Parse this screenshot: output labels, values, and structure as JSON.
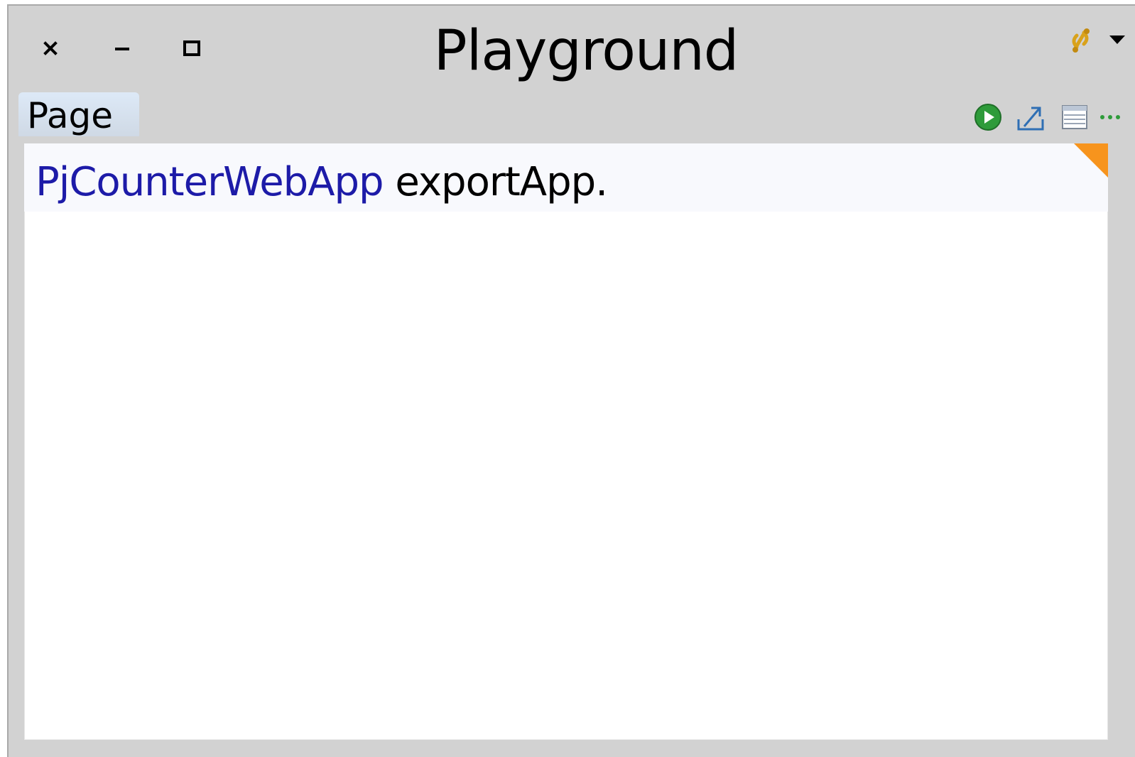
{
  "window": {
    "title": "Playground",
    "controls": {
      "close_icon": "close-icon",
      "minimize_icon": "minimize-icon",
      "maximize_icon": "maximize-icon"
    },
    "menu_icon": "window-menu-icon"
  },
  "tabs": [
    {
      "label": "Page",
      "selected": true
    }
  ],
  "toolbar": {
    "icons": [
      "run-icon",
      "export-icon",
      "inspect-icon",
      "more-icon"
    ]
  },
  "editor": {
    "code": {
      "receiver": "PjCounterWebApp",
      "message": " exportApp."
    },
    "corner_badge_color": "#f7941d"
  },
  "colors": {
    "window_background": "#d2d2d2",
    "tab_background": "#dde9f7",
    "class_name": "#1d1ba8",
    "run_green": "#2e9b3a",
    "export_blue": "#2f6fb4",
    "menu_icon_gold": "#d9a21b"
  }
}
